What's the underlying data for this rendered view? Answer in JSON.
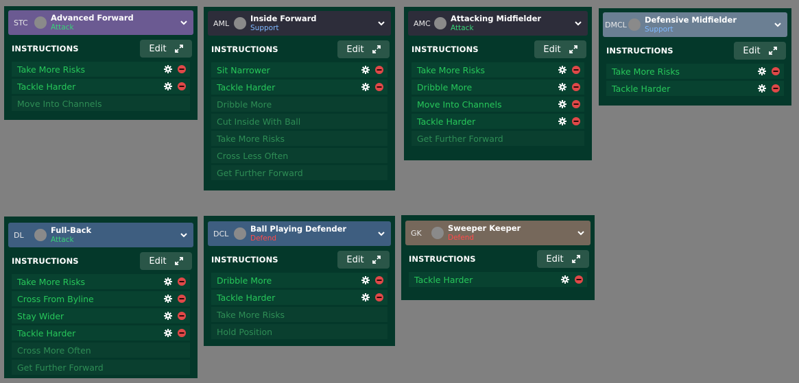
{
  "colors": {
    "card_bg": "#04382a",
    "attack": "#38d278",
    "support": "#7fb8ff",
    "defend": "#ff4a4a",
    "active_text": "#27c75a",
    "inactive_text": "#2e8d55",
    "remove": "#e04848"
  },
  "edit_label": "Edit",
  "instructions_label": "INSTRUCTIONS",
  "cards": [
    {
      "id": "stc",
      "position": "STC",
      "role": "Advanced Forward",
      "duty": "Attack",
      "header_color": "#6b5a92",
      "items": [
        {
          "label": "Take More Risks",
          "active": true
        },
        {
          "label": "Tackle Harder",
          "active": true
        },
        {
          "label": "Move Into Channels",
          "active": false
        }
      ]
    },
    {
      "id": "aml",
      "position": "AML",
      "role": "Inside Forward",
      "duty": "Support",
      "header_color": "#2d2d3a",
      "items": [
        {
          "label": "Sit Narrower",
          "active": true
        },
        {
          "label": "Tackle Harder",
          "active": true
        },
        {
          "label": "Dribble More",
          "active": false
        },
        {
          "label": "Cut Inside With Ball",
          "active": false
        },
        {
          "label": "Take More Risks",
          "active": false
        },
        {
          "label": "Cross Less Often",
          "active": false
        },
        {
          "label": "Get Further Forward",
          "active": false
        }
      ]
    },
    {
      "id": "amc",
      "position": "AMC",
      "role": "Attacking Midfielder",
      "duty": "Attack",
      "header_color": "#2d2d3a",
      "items": [
        {
          "label": "Take More Risks",
          "active": true
        },
        {
          "label": "Dribble More",
          "active": true
        },
        {
          "label": "Move Into Channels",
          "active": true
        },
        {
          "label": "Tackle Harder",
          "active": true
        },
        {
          "label": "Get Further Forward",
          "active": false
        }
      ]
    },
    {
      "id": "dmcl",
      "position": "DMCL",
      "role": "Defensive Midfielder",
      "duty": "Support",
      "header_color": "#6b7f93",
      "items": [
        {
          "label": "Take More Risks",
          "active": true
        },
        {
          "label": "Tackle Harder",
          "active": true
        }
      ]
    },
    {
      "id": "dl",
      "position": "DL",
      "role": "Full-Back",
      "duty": "Attack",
      "header_color": "#3e5e80",
      "items": [
        {
          "label": "Take More Risks",
          "active": true
        },
        {
          "label": "Cross From Byline",
          "active": true
        },
        {
          "label": "Stay Wider",
          "active": true
        },
        {
          "label": "Tackle Harder",
          "active": true
        },
        {
          "label": "Cross More Often",
          "active": false
        },
        {
          "label": "Get Further Forward",
          "active": false
        }
      ]
    },
    {
      "id": "dcl",
      "position": "DCL",
      "role": "Ball Playing Defender",
      "duty": "Defend",
      "header_color": "#3e5e80",
      "items": [
        {
          "label": "Dribble More",
          "active": true
        },
        {
          "label": "Tackle Harder",
          "active": true
        },
        {
          "label": "Take More Risks",
          "active": false
        },
        {
          "label": "Hold Position",
          "active": false
        }
      ]
    },
    {
      "id": "gk",
      "position": "GK",
      "role": "Sweeper Keeper",
      "duty": "Defend",
      "header_color": "#76685b",
      "items": [
        {
          "label": "Tackle Harder",
          "active": true
        }
      ]
    }
  ]
}
